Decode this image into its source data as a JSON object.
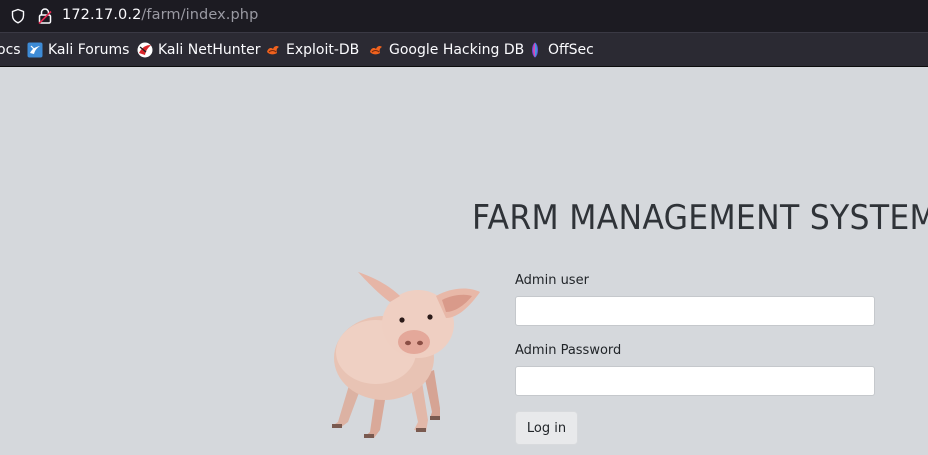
{
  "browser": {
    "url_host": "172.17.0.2",
    "url_path": "/farm/index.php"
  },
  "bookmarks": [
    {
      "label": "ocs",
      "icon": "none"
    },
    {
      "label": "Kali Forums",
      "icon": "kali-forums-icon"
    },
    {
      "label": "Kali NetHunter",
      "icon": "kali-nethunter-icon"
    },
    {
      "label": "Exploit-DB",
      "icon": "exploit-db-icon"
    },
    {
      "label": "Google Hacking DB",
      "icon": "google-hacking-db-icon"
    },
    {
      "label": "OffSec",
      "icon": "offsec-icon"
    }
  ],
  "page": {
    "title": "FARM MANAGEMENT SYSTEM",
    "image": "pig-image",
    "form": {
      "user_label": "Admin user",
      "user_value": "",
      "password_label": "Admin Password",
      "password_value": "",
      "submit_label": "Log in"
    }
  },
  "colors": {
    "page_background": "#d5d8dc",
    "title_color": "#2f3338",
    "urlbar_background": "#1c1b22",
    "bookmarks_background": "#2b2a33"
  }
}
